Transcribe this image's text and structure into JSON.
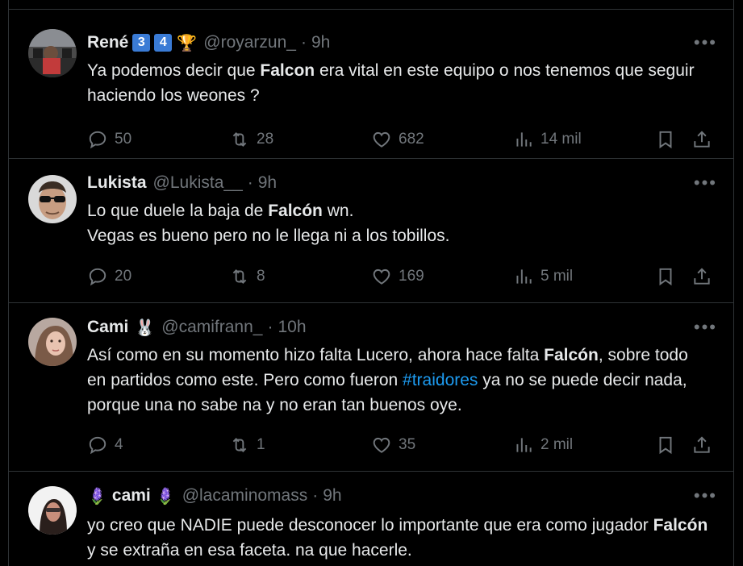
{
  "tweets": [
    {
      "name": "René",
      "badges": [
        "3",
        "4"
      ],
      "emoji": "🏆",
      "handle": "@royarzun_",
      "time": "9h",
      "text_parts": [
        "Ya podemos decir que ",
        "Falcon",
        " era vital en este equipo o nos tenemos que seguir haciendo los weones ?"
      ],
      "replies": "50",
      "retweets": "28",
      "likes": "682",
      "views": "14 mil"
    },
    {
      "name": "Lukista",
      "handle": "@Lukista__",
      "time": "9h",
      "text_parts": [
        "Lo que duele la baja de ",
        "Falcón",
        " wn.",
        "Vegas es bueno pero no le llega ni a los tobillos."
      ],
      "replies": "20",
      "retweets": "8",
      "likes": "169",
      "views": "5 mil"
    },
    {
      "name": "Cami",
      "emoji": "🐰",
      "handle": "@camifrann_",
      "time": "10h",
      "text_parts": [
        "Así como en su momento hizo falta Lucero, ahora hace falta ",
        "Falcón",
        ", sobre todo en partidos como este. Pero como fueron ",
        "#traidores",
        " ya no se puede decir nada, porque una no sabe na y no eran tan buenos oye."
      ],
      "replies": "4",
      "retweets": "1",
      "likes": "35",
      "views": "2 mil"
    },
    {
      "name": "cami",
      "emoji_left": "🪻",
      "emoji_right": "🪻",
      "handle": "@lacaminomass",
      "time": "9h",
      "text_parts": [
        "yo creo que NADIE puede desconocer lo importante que era como jugador ",
        "Falcón",
        " y se extraña en esa faceta. na que hacerle."
      ]
    }
  ],
  "separator": "·",
  "more_icon": "more-icon",
  "colors": {
    "background": "#000000",
    "text": "#e7e9ea",
    "muted": "#71767b",
    "link": "#1d9bf0",
    "border": "#2f3336"
  }
}
